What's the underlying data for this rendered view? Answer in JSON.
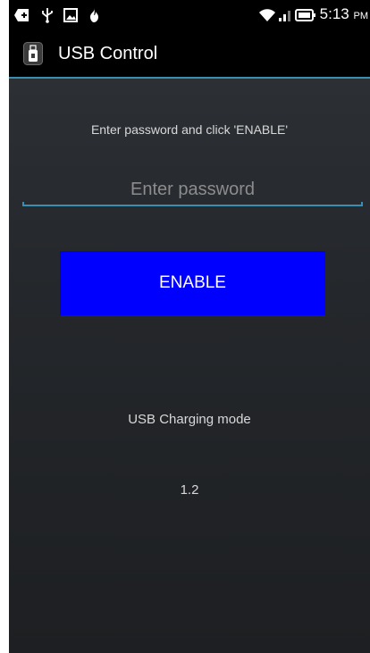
{
  "status_bar": {
    "time": "5:13",
    "ampm": "PM",
    "icons": [
      "add-box-icon",
      "usb-icon",
      "image-icon",
      "flame-icon",
      "wifi-icon",
      "signal-icon",
      "battery-icon"
    ]
  },
  "action_bar": {
    "title": "USB Control",
    "app_icon": "usb-stick-icon"
  },
  "main": {
    "instruction": "Enter password and click 'ENABLE'",
    "password_placeholder": "Enter password",
    "password_value": "",
    "enable_label": "ENABLE",
    "mode_label": "USB Charging mode",
    "version": "1.2"
  },
  "colors": {
    "accent": "#3a8fb0",
    "button": "#0000ff",
    "background": "#25282c"
  }
}
